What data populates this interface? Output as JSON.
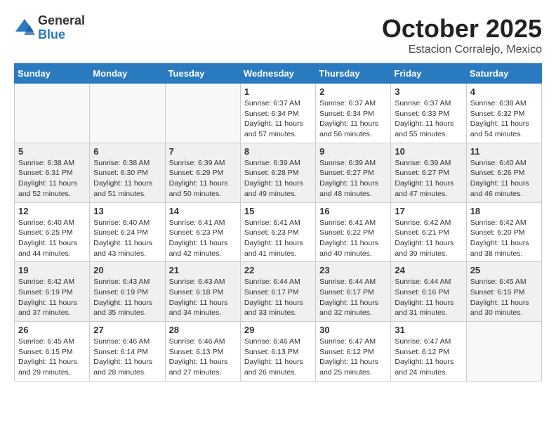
{
  "logo": {
    "general": "General",
    "blue": "Blue"
  },
  "title": "October 2025",
  "subtitle": "Estacion Corralejo, Mexico",
  "headers": [
    "Sunday",
    "Monday",
    "Tuesday",
    "Wednesday",
    "Thursday",
    "Friday",
    "Saturday"
  ],
  "weeks": [
    [
      {
        "day": "",
        "info": ""
      },
      {
        "day": "",
        "info": ""
      },
      {
        "day": "",
        "info": ""
      },
      {
        "day": "1",
        "info": "Sunrise: 6:37 AM\nSunset: 6:34 PM\nDaylight: 11 hours\nand 57 minutes."
      },
      {
        "day": "2",
        "info": "Sunrise: 6:37 AM\nSunset: 6:34 PM\nDaylight: 11 hours\nand 56 minutes."
      },
      {
        "day": "3",
        "info": "Sunrise: 6:37 AM\nSunset: 6:33 PM\nDaylight: 11 hours\nand 55 minutes."
      },
      {
        "day": "4",
        "info": "Sunrise: 6:38 AM\nSunset: 6:32 PM\nDaylight: 11 hours\nand 54 minutes."
      }
    ],
    [
      {
        "day": "5",
        "info": "Sunrise: 6:38 AM\nSunset: 6:31 PM\nDaylight: 11 hours\nand 52 minutes."
      },
      {
        "day": "6",
        "info": "Sunrise: 6:38 AM\nSunset: 6:30 PM\nDaylight: 11 hours\nand 51 minutes."
      },
      {
        "day": "7",
        "info": "Sunrise: 6:39 AM\nSunset: 6:29 PM\nDaylight: 11 hours\nand 50 minutes."
      },
      {
        "day": "8",
        "info": "Sunrise: 6:39 AM\nSunset: 6:28 PM\nDaylight: 11 hours\nand 49 minutes."
      },
      {
        "day": "9",
        "info": "Sunrise: 6:39 AM\nSunset: 6:27 PM\nDaylight: 11 hours\nand 48 minutes."
      },
      {
        "day": "10",
        "info": "Sunrise: 6:39 AM\nSunset: 6:27 PM\nDaylight: 11 hours\nand 47 minutes."
      },
      {
        "day": "11",
        "info": "Sunrise: 6:40 AM\nSunset: 6:26 PM\nDaylight: 11 hours\nand 46 minutes."
      }
    ],
    [
      {
        "day": "12",
        "info": "Sunrise: 6:40 AM\nSunset: 6:25 PM\nDaylight: 11 hours\nand 44 minutes."
      },
      {
        "day": "13",
        "info": "Sunrise: 6:40 AM\nSunset: 6:24 PM\nDaylight: 11 hours\nand 43 minutes."
      },
      {
        "day": "14",
        "info": "Sunrise: 6:41 AM\nSunset: 6:23 PM\nDaylight: 11 hours\nand 42 minutes."
      },
      {
        "day": "15",
        "info": "Sunrise: 6:41 AM\nSunset: 6:23 PM\nDaylight: 11 hours\nand 41 minutes."
      },
      {
        "day": "16",
        "info": "Sunrise: 6:41 AM\nSunset: 6:22 PM\nDaylight: 11 hours\nand 40 minutes."
      },
      {
        "day": "17",
        "info": "Sunrise: 6:42 AM\nSunset: 6:21 PM\nDaylight: 11 hours\nand 39 minutes."
      },
      {
        "day": "18",
        "info": "Sunrise: 6:42 AM\nSunset: 6:20 PM\nDaylight: 11 hours\nand 38 minutes."
      }
    ],
    [
      {
        "day": "19",
        "info": "Sunrise: 6:42 AM\nSunset: 6:19 PM\nDaylight: 11 hours\nand 37 minutes."
      },
      {
        "day": "20",
        "info": "Sunrise: 6:43 AM\nSunset: 6:19 PM\nDaylight: 11 hours\nand 35 minutes."
      },
      {
        "day": "21",
        "info": "Sunrise: 6:43 AM\nSunset: 6:18 PM\nDaylight: 11 hours\nand 34 minutes."
      },
      {
        "day": "22",
        "info": "Sunrise: 6:44 AM\nSunset: 6:17 PM\nDaylight: 11 hours\nand 33 minutes."
      },
      {
        "day": "23",
        "info": "Sunrise: 6:44 AM\nSunset: 6:17 PM\nDaylight: 11 hours\nand 32 minutes."
      },
      {
        "day": "24",
        "info": "Sunrise: 6:44 AM\nSunset: 6:16 PM\nDaylight: 11 hours\nand 31 minutes."
      },
      {
        "day": "25",
        "info": "Sunrise: 6:45 AM\nSunset: 6:15 PM\nDaylight: 11 hours\nand 30 minutes."
      }
    ],
    [
      {
        "day": "26",
        "info": "Sunrise: 6:45 AM\nSunset: 6:15 PM\nDaylight: 11 hours\nand 29 minutes."
      },
      {
        "day": "27",
        "info": "Sunrise: 6:46 AM\nSunset: 6:14 PM\nDaylight: 11 hours\nand 28 minutes."
      },
      {
        "day": "28",
        "info": "Sunrise: 6:46 AM\nSunset: 6:13 PM\nDaylight: 11 hours\nand 27 minutes."
      },
      {
        "day": "29",
        "info": "Sunrise: 6:46 AM\nSunset: 6:13 PM\nDaylight: 11 hours\nand 26 minutes."
      },
      {
        "day": "30",
        "info": "Sunrise: 6:47 AM\nSunset: 6:12 PM\nDaylight: 11 hours\nand 25 minutes."
      },
      {
        "day": "31",
        "info": "Sunrise: 6:47 AM\nSunset: 6:12 PM\nDaylight: 11 hours\nand 24 minutes."
      },
      {
        "day": "",
        "info": ""
      }
    ]
  ]
}
